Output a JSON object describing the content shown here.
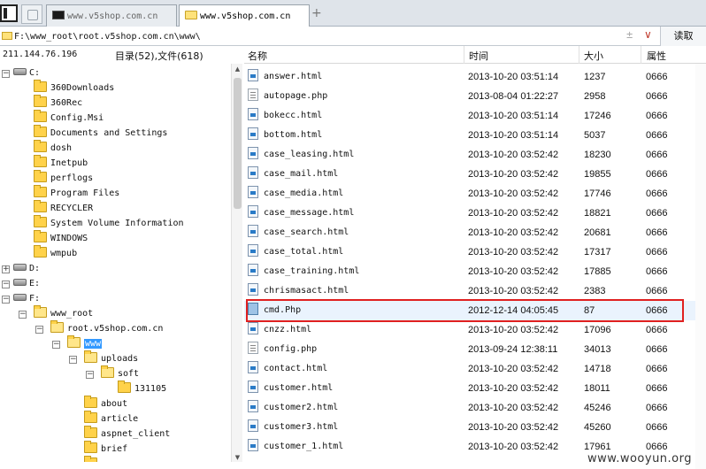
{
  "tabs": [
    {
      "label": "www.v5shop.com.cn",
      "icon": "terminal-icon",
      "active": false
    },
    {
      "label": "www.v5shop.com.cn",
      "icon": "folder-icon",
      "active": true
    }
  ],
  "tab_close": "×",
  "tab_add": "+",
  "address": {
    "path": "F:\\www_root\\root.v5shop.com.cn\\www\\",
    "plus": "±",
    "dropdown": "∨",
    "read_button": "读取"
  },
  "info": {
    "ip": "211.144.76.196",
    "counts": "目录(52),文件(618)"
  },
  "tree": [
    {
      "label": "C:",
      "type": "drive",
      "expander": "−"
    },
    {
      "label": "360Downloads",
      "type": "folder"
    },
    {
      "label": "360Rec",
      "type": "folder"
    },
    {
      "label": "Config.Msi",
      "type": "folder"
    },
    {
      "label": "Documents and Settings",
      "type": "folder"
    },
    {
      "label": "dosh",
      "type": "folder"
    },
    {
      "label": "Inetpub",
      "type": "folder"
    },
    {
      "label": "perflogs",
      "type": "folder"
    },
    {
      "label": "Program Files",
      "type": "folder"
    },
    {
      "label": "RECYCLER",
      "type": "folder"
    },
    {
      "label": "System Volume Information",
      "type": "folder"
    },
    {
      "label": "WINDOWS",
      "type": "folder"
    },
    {
      "label": "wmpub",
      "type": "folder"
    },
    {
      "label": "D:",
      "type": "drive",
      "expander": "+"
    },
    {
      "label": "E:",
      "type": "drive",
      "expander": "−"
    },
    {
      "label": "F:",
      "type": "drive",
      "expander": "−"
    },
    {
      "label": "www_root",
      "type": "folder",
      "expander": "−"
    },
    {
      "label": "root.v5shop.com.cn",
      "type": "folder",
      "expander": "−"
    },
    {
      "label": "www",
      "type": "folder",
      "expander": "−",
      "selected": true
    },
    {
      "label": "uploads",
      "type": "folder",
      "expander": "−"
    },
    {
      "label": "soft",
      "type": "folder",
      "expander": "−"
    },
    {
      "label": "131105",
      "type": "folder"
    },
    {
      "label": "about",
      "type": "folder"
    },
    {
      "label": "article",
      "type": "folder"
    },
    {
      "label": "aspnet_client",
      "type": "folder"
    },
    {
      "label": "brief",
      "type": "folder"
    },
    {
      "label": "",
      "type": "folder"
    }
  ],
  "scroll_arrows": {
    "up": "▲",
    "down": "▼"
  },
  "columns": {
    "name": "名称",
    "time": "时间",
    "size": "大小",
    "attr": "属性"
  },
  "files": [
    {
      "name": "answer.html",
      "time": "2013-10-20 03:51:14",
      "size": "1237",
      "attr": "0666",
      "icon": "html"
    },
    {
      "name": "autopage.php",
      "time": "2013-08-04 01:22:27",
      "size": "2958",
      "attr": "0666",
      "icon": "php"
    },
    {
      "name": "bokecc.html",
      "time": "2013-10-20 03:51:14",
      "size": "17246",
      "attr": "0666",
      "icon": "html"
    },
    {
      "name": "bottom.html",
      "time": "2013-10-20 03:51:14",
      "size": "5037",
      "attr": "0666",
      "icon": "html"
    },
    {
      "name": "case_leasing.html",
      "time": "2013-10-20 03:52:42",
      "size": "18230",
      "attr": "0666",
      "icon": "html"
    },
    {
      "name": "case_mail.html",
      "time": "2013-10-20 03:52:42",
      "size": "19855",
      "attr": "0666",
      "icon": "html"
    },
    {
      "name": "case_media.html",
      "time": "2013-10-20 03:52:42",
      "size": "17746",
      "attr": "0666",
      "icon": "html"
    },
    {
      "name": "case_message.html",
      "time": "2013-10-20 03:52:42",
      "size": "18821",
      "attr": "0666",
      "icon": "html"
    },
    {
      "name": "case_search.html",
      "time": "2013-10-20 03:52:42",
      "size": "20681",
      "attr": "0666",
      "icon": "html"
    },
    {
      "name": "case_total.html",
      "time": "2013-10-20 03:52:42",
      "size": "17317",
      "attr": "0666",
      "icon": "html"
    },
    {
      "name": "case_training.html",
      "time": "2013-10-20 03:52:42",
      "size": "17885",
      "attr": "0666",
      "icon": "html"
    },
    {
      "name": "chrismasact.html",
      "time": "2013-10-20 03:52:42",
      "size": "2383",
      "attr": "0666",
      "icon": "html"
    },
    {
      "name": "cmd.Php",
      "time": "2012-12-14 04:05:45",
      "size": "87",
      "attr": "0666",
      "icon": "blue",
      "highlighted": true
    },
    {
      "name": "cnzz.html",
      "time": "2013-10-20 03:52:42",
      "size": "17096",
      "attr": "0666",
      "icon": "html"
    },
    {
      "name": "config.php",
      "time": "2013-09-24 12:38:11",
      "size": "34013",
      "attr": "0666",
      "icon": "php"
    },
    {
      "name": "contact.html",
      "time": "2013-10-20 03:52:42",
      "size": "14718",
      "attr": "0666",
      "icon": "html"
    },
    {
      "name": "customer.html",
      "time": "2013-10-20 03:52:42",
      "size": "18011",
      "attr": "0666",
      "icon": "html"
    },
    {
      "name": "customer2.html",
      "time": "2013-10-20 03:52:42",
      "size": "45246",
      "attr": "0666",
      "icon": "html"
    },
    {
      "name": "customer3.html",
      "time": "2013-10-20 03:52:42",
      "size": "45260",
      "attr": "0666",
      "icon": "html"
    },
    {
      "name": "customer_1.html",
      "time": "2013-10-20 03:52:42",
      "size": "17961",
      "attr": "0666",
      "icon": "html"
    }
  ],
  "watermark": "www.wooyun.org",
  "colors": {
    "highlight_border": "#e02020",
    "selection": "#3399ff",
    "folder": "#ffd24a"
  }
}
